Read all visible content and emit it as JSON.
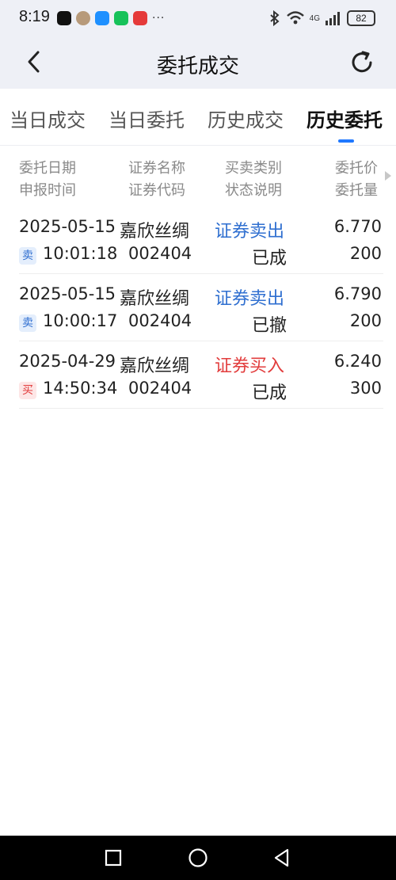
{
  "status_bar": {
    "time": "8:19",
    "more": "···",
    "network": "4G",
    "battery": "82"
  },
  "nav": {
    "title": "委托成交"
  },
  "tabs": [
    {
      "label": "当日成交",
      "active": false
    },
    {
      "label": "当日委托",
      "active": false
    },
    {
      "label": "历史成交",
      "active": false
    },
    {
      "label": "历史委托",
      "active": true
    }
  ],
  "header": {
    "col1_line1": "委托日期",
    "col1_line2": "申报时间",
    "col2_line1": "证券名称",
    "col2_line2": "证券代码",
    "col3_line1": "买卖类别",
    "col3_line2": "状态说明",
    "col4_line1": "委托价",
    "col4_line2": "委托量"
  },
  "rows": [
    {
      "date": "2025-05-15",
      "name": "嘉欣丝绸",
      "type": "证券卖出",
      "price": "6.770",
      "badge": "卖",
      "time": "10:01:18",
      "code": "002404",
      "status": "已成",
      "qty": "200"
    },
    {
      "date": "2025-05-15",
      "name": "嘉欣丝绸",
      "type": "证券卖出",
      "price": "6.790",
      "badge": "卖",
      "time": "10:00:17",
      "code": "002404",
      "status": "已撤",
      "qty": "200"
    },
    {
      "date": "2025-04-29",
      "name": "嘉欣丝绸",
      "type": "证券买入",
      "price": "6.240",
      "badge": "买",
      "time": "14:50:34",
      "code": "002404",
      "status": "已成",
      "qty": "300"
    }
  ],
  "colors": {
    "sell": "#2f6fd0",
    "buy": "#e23d3d",
    "accent": "#1f78ff"
  },
  "icons": {
    "back": "chevron-left-icon",
    "refresh": "refresh-icon",
    "bottom_nav": [
      "square-icon",
      "circle-icon",
      "triangle-back-icon"
    ]
  }
}
